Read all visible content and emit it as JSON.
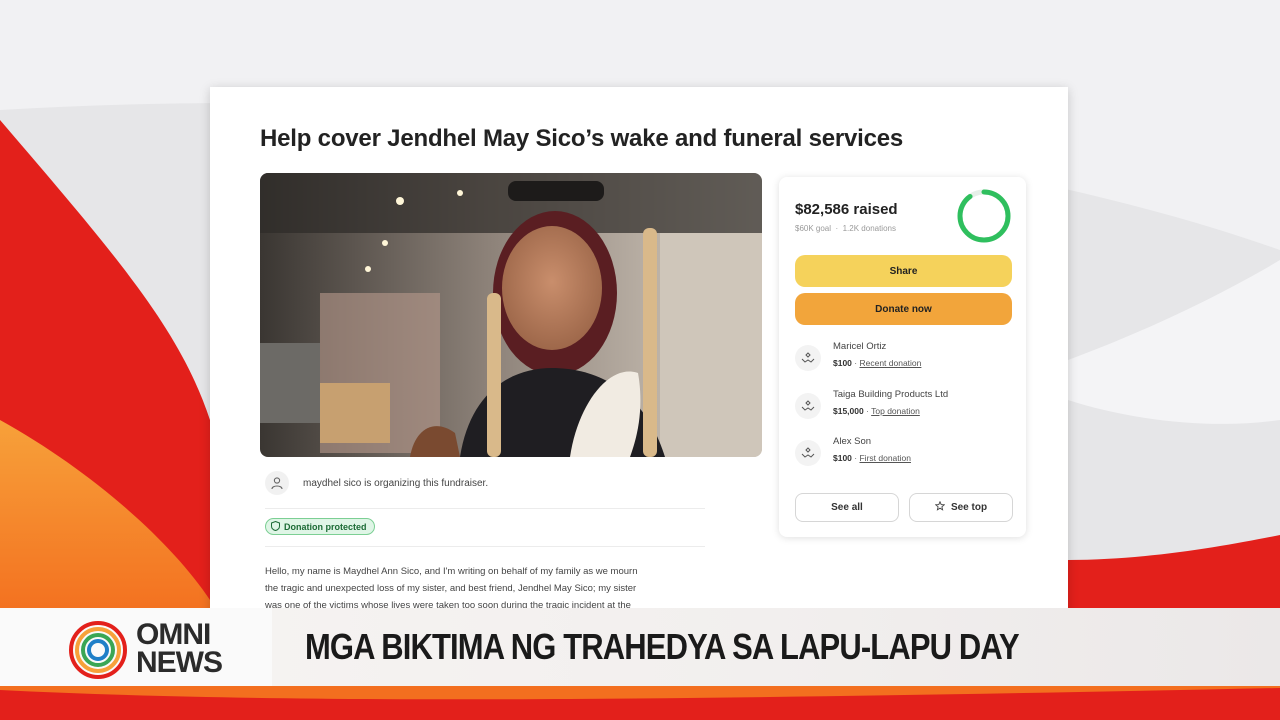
{
  "fundraiser": {
    "title": "Help cover Jendhel May Sico’s wake and funeral services",
    "organizer_text": "maydhel sico is organizing this fundraiser.",
    "protected_badge": "Donation protected",
    "story_lines": [
      "Hello, my name is Maydhel Ann Sico, and I'm writing on behalf of my family as we mourn",
      "the tragic and unexpected loss of my sister, and best friend, Jendhel May Sico; my sister",
      "was one of the victims whose lives were taken too soon during the tragic incident at the"
    ]
  },
  "panel": {
    "raised": "$82,586 raised",
    "goal": "$60K goal",
    "donations": "1.2K donations",
    "progress_fraction": 0.9,
    "share_label": "Share",
    "donate_label": "Donate now",
    "donors": [
      {
        "name": "Maricel Ortiz",
        "amount": "$100",
        "tag": "Recent donation"
      },
      {
        "name": "Taiga Building Products Ltd",
        "amount": "$15,000",
        "tag": "Top donation"
      },
      {
        "name": "Alex Son",
        "amount": "$100",
        "tag": "First donation"
      }
    ],
    "see_all_label": "See all",
    "see_top_label": "See top",
    "share_color": "#f5d25b",
    "donate_color": "#f2a53b",
    "ring_color": "#2fbf5e"
  },
  "broadcast": {
    "logo_top": "OMNI",
    "logo_bottom": "NEWS",
    "headline": "MGA BIKTIMA NG TRAHEDYA SA LAPU-LAPU DAY",
    "accent_red": "#e3201b"
  },
  "icons": {
    "organizer": "user-icon",
    "protected": "shield-check-icon",
    "donor": "heart-hands-icon",
    "see_top": "star-icon"
  }
}
